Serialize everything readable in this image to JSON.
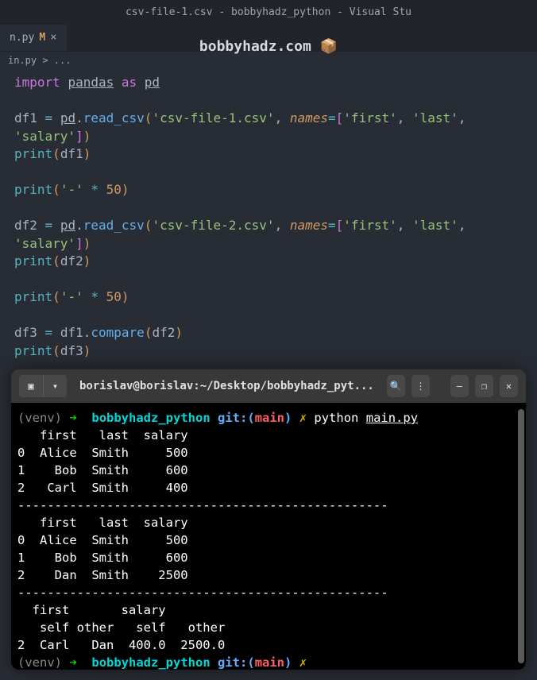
{
  "titlebar": "csv-file-1.csv - bobbyhadz_python - Visual Stu",
  "tab": {
    "name": "n.py",
    "modified": "M",
    "close": "×"
  },
  "watermark": "bobbyhadz.com 📦",
  "breadcrumb": "in.py > ...",
  "code": {
    "l1": {
      "import": "import",
      "pandas": "pandas",
      "as": "as",
      "pd": "pd"
    },
    "l3": {
      "df1": "df1",
      "eq": "=",
      "pd": "pd",
      "dot": ".",
      "read_csv": "read_csv",
      "op": "(",
      "file": "'csv-file-1.csv'",
      "comma": ",",
      "names": "names",
      "eq2": "=",
      "ob": "[",
      "first": "'first'",
      "c2": ",",
      "last": "'last'",
      "c3": ","
    },
    "l4": {
      "salary": "'salary'",
      "cb": "]",
      "cp": ")"
    },
    "l5": {
      "print": "print",
      "op": "(",
      "df1": "df1",
      "cp": ")"
    },
    "l7": {
      "print": "print",
      "op": "(",
      "dash": "'-'",
      "mul": "*",
      "fifty": "50",
      "cp": ")"
    },
    "l9": {
      "df2": "df2",
      "eq": "=",
      "pd": "pd",
      "dot": ".",
      "read_csv": "read_csv",
      "op": "(",
      "file": "'csv-file-2.csv'",
      "comma": ",",
      "names": "names",
      "eq2": "=",
      "ob": "[",
      "first": "'first'",
      "c2": ",",
      "last": "'last'",
      "c3": ","
    },
    "l10": {
      "salary": "'salary'",
      "cb": "]",
      "cp": ")"
    },
    "l11": {
      "print": "print",
      "op": "(",
      "df2": "df2",
      "cp": ")"
    },
    "l13": {
      "print": "print",
      "op": "(",
      "dash": "'-'",
      "mul": "*",
      "fifty": "50",
      "cp": ")"
    },
    "l15": {
      "df3": "df3",
      "eq": "=",
      "df1": "df1",
      "dot": ".",
      "compare": "compare",
      "op": "(",
      "df2": "df2",
      "cp": ")"
    },
    "l16": {
      "print": "print",
      "op": "(",
      "df3": "df3",
      "cp": ")"
    }
  },
  "terminal": {
    "title": "borislav@borislav:~/Desktop/bobbyhadz_pyt...",
    "search": "🔍",
    "menu": "⋮",
    "min": "—",
    "max": "❐",
    "close": "✕",
    "prompt1": {
      "venv": "(venv)",
      "arrow": "➜",
      "dir": "bobbyhadz_python",
      "git": "git:(",
      "branch": "main",
      "gitclose": ")",
      "x": "✗",
      "cmd": "python",
      "arg": "main.py"
    },
    "out": {
      "hdr1": "   first   last  salary",
      "r0": "0  Alice  Smith     500",
      "r1": "1    Bob  Smith     600",
      "r2": "2   Carl  Smith     400",
      "dash1": "--------------------------------------------------",
      "hdr2": "   first   last  salary",
      "r3": "0  Alice  Smith     500",
      "r4": "1    Bob  Smith     600",
      "r5": "2    Dan  Smith    2500",
      "dash2": "--------------------------------------------------",
      "hdr3": "  first       salary        ",
      "hdr4": "   self other   self   other",
      "r6": "2  Carl   Dan  400.0  2500.0"
    },
    "prompt2": {
      "venv": "(venv)",
      "arrow": "➜",
      "dir": "bobbyhadz_python",
      "git": "git:(",
      "branch": "main",
      "gitclose": ")",
      "x": "✗"
    }
  }
}
